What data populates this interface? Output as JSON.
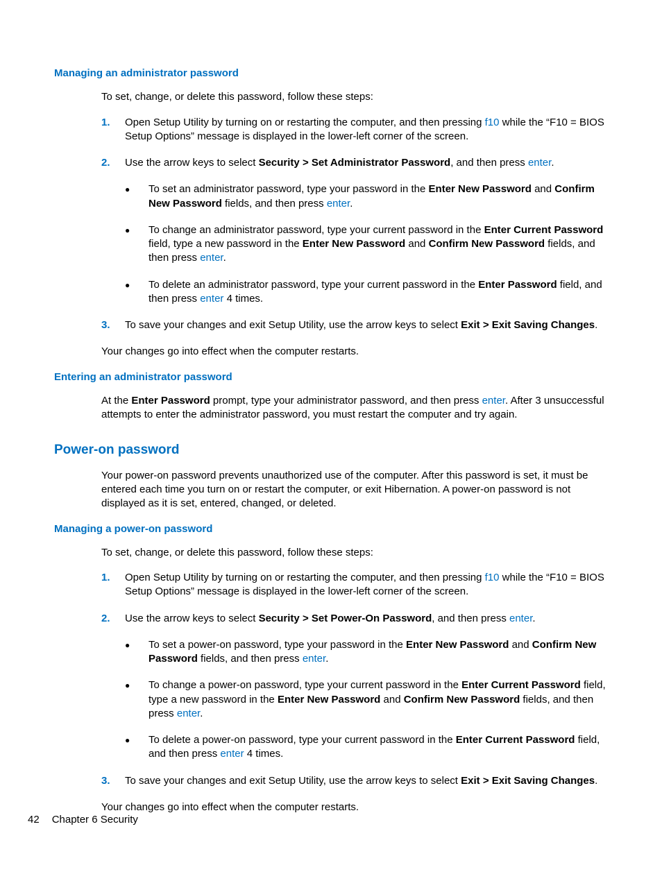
{
  "s1": {
    "heading": "Managing an administrator password",
    "intro": "To set, change, or delete this password, follow these steps:",
    "step1": {
      "num": "1.",
      "t1": "Open Setup Utility by turning on or restarting the computer, and then pressing ",
      "key": "f10",
      "t2": " while the “F10 = BIOS Setup Options” message is displayed in the lower-left corner of the screen."
    },
    "step2": {
      "num": "2.",
      "t1": "Use the arrow keys to select ",
      "bold": "Security > Set Administrator Password",
      "t2": ", and then press ",
      "key": "enter",
      "t3": ".",
      "b1": {
        "t1": "To set an administrator password, type your password in the ",
        "b1": "Enter New Password",
        "t2": " and ",
        "b2": "Confirm New Password",
        "t3": " fields, and then press ",
        "key": "enter",
        "t4": "."
      },
      "b2": {
        "t1": "To change an administrator password, type your current password in the ",
        "b1": "Enter Current Password",
        "t2": " field, type a new password in the ",
        "b2": "Enter New Password",
        "t3": " and ",
        "b3": "Confirm New Password",
        "t4": " fields, and then press ",
        "key": "enter",
        "t5": "."
      },
      "b3": {
        "t1": "To delete an administrator password, type your current password in the ",
        "b1": "Enter Password",
        "t2": " field, and then press ",
        "key": "enter",
        "t3": " 4 times."
      }
    },
    "step3": {
      "num": "3.",
      "t1": "To save your changes and exit Setup Utility, use the arrow keys to select ",
      "bold": "Exit > Exit Saving Changes",
      "t2": "."
    },
    "outro": "Your changes go into effect when the computer restarts."
  },
  "s2": {
    "heading": "Entering an administrator password",
    "p": {
      "t1": "At the ",
      "b1": "Enter Password",
      "t2": " prompt, type your administrator password, and then press ",
      "key": "enter",
      "t3": ". After 3 unsuccessful attempts to enter the administrator password, you must restart the computer and try again."
    }
  },
  "s3": {
    "heading": "Power-on password",
    "intro": "Your power-on password prevents unauthorized use of the computer. After this password is set, it must be entered each time you turn on or restart the computer, or exit Hibernation. A power-on password is not displayed as it is set, entered, changed, or deleted."
  },
  "s4": {
    "heading": "Managing a power-on password",
    "intro": "To set, change, or delete this password, follow these steps:",
    "step1": {
      "num": "1.",
      "t1": "Open Setup Utility by turning on or restarting the computer, and then pressing ",
      "key": "f10",
      "t2": " while the “F10 = BIOS Setup Options” message is displayed in the lower-left corner of the screen."
    },
    "step2": {
      "num": "2.",
      "t1": "Use the arrow keys to select ",
      "bold": "Security > Set Power-On Password",
      "t2": ", and then press ",
      "key": "enter",
      "t3": ".",
      "b1": {
        "t1": "To set a power-on password, type your password in the ",
        "b1": "Enter New Password",
        "t2": " and ",
        "b2": "Confirm New Password",
        "t3": " fields, and then press ",
        "key": "enter",
        "t4": "."
      },
      "b2": {
        "t1": "To change a power-on password, type your current password in the ",
        "b1": "Enter Current Password",
        "t2": " field, type a new password in the ",
        "b2": "Enter New Password",
        "t3": " and ",
        "b3": "Confirm New Password",
        "t4": " fields, and then press ",
        "key": "enter",
        "t5": "."
      },
      "b3": {
        "t1": "To delete a power-on password, type your current password in the ",
        "b1": "Enter Current Password",
        "t2": " field, and then press ",
        "key": "enter",
        "t3": " 4 times."
      }
    },
    "step3": {
      "num": "3.",
      "t1": "To save your changes and exit Setup Utility, use the arrow keys to select ",
      "bold": "Exit > Exit Saving Changes",
      "t2": "."
    },
    "outro": "Your changes go into effect when the computer restarts."
  },
  "footer": {
    "page": "42",
    "chapter": "Chapter 6   Security"
  },
  "glyph": {
    "bullet": "●"
  }
}
